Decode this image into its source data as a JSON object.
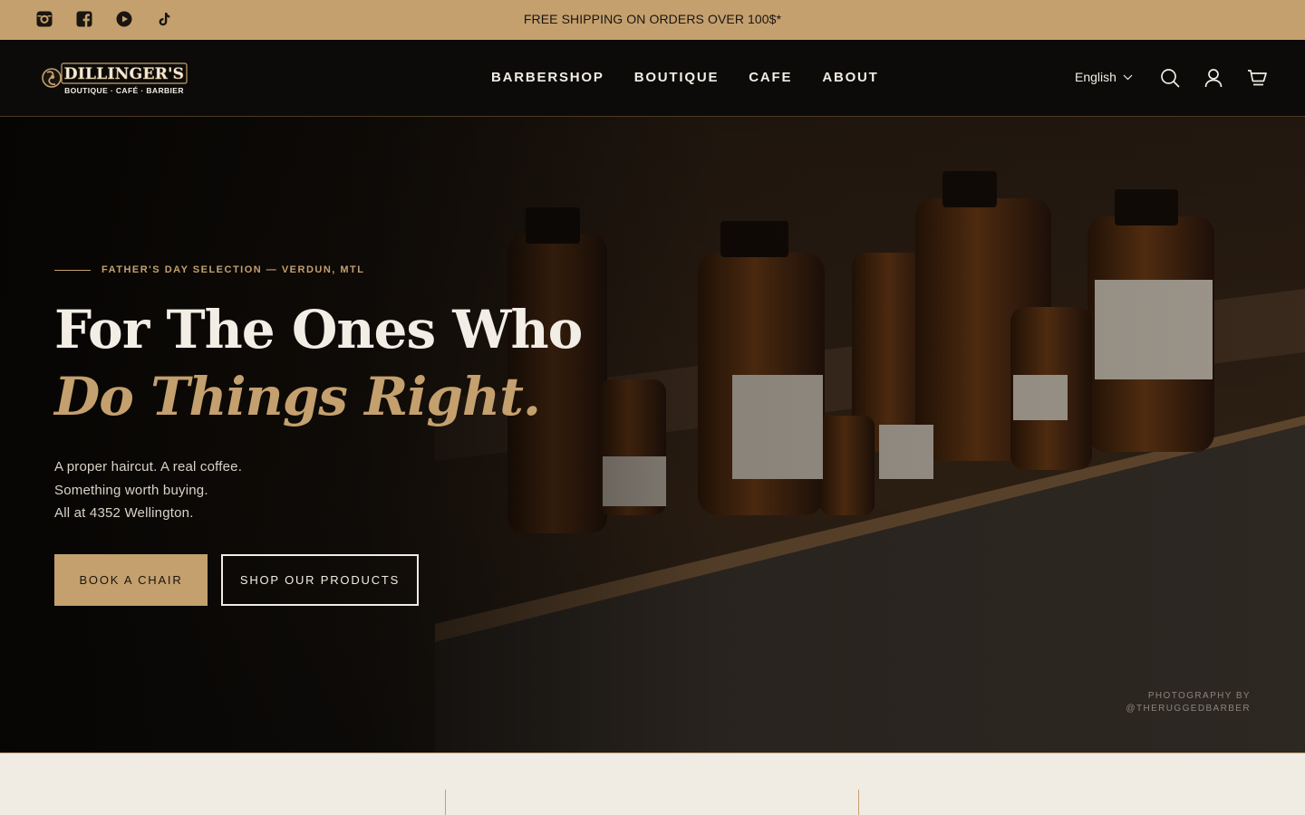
{
  "announcement": {
    "text": "FREE SHIPPING ON ORDERS OVER 100$*",
    "social_icons": [
      "instagram-icon",
      "facebook-icon",
      "youtube-icon",
      "tiktok-icon"
    ]
  },
  "header": {
    "logo": {
      "name": "DILLINGER'S",
      "tagline": "BOUTIQUE · CAFÉ · BARBIER"
    },
    "nav": [
      "BARBERSHOP",
      "BOUTIQUE",
      "CAFE",
      "ABOUT"
    ],
    "language": "English",
    "icons": [
      "search-icon",
      "account-icon",
      "cart-icon"
    ]
  },
  "hero": {
    "eyebrow": "FATHER'S DAY SELECTION — VERDUN, MTL",
    "headline_line1": "For The Ones Who",
    "headline_line2": "Do Things Right.",
    "subtext": [
      "A proper haircut. A real coffee.",
      "Something worth buying.",
      "All at 4352 Wellington."
    ],
    "primary_button": "BOOK A CHAIR",
    "secondary_button": "SHOP OUR PRODUCTS",
    "credit_line1": "PHOTOGRAPHY BY",
    "credit_line2": "@THERUGGEDBARBER"
  },
  "colors": {
    "accent": "#c4a06e",
    "header_bg": "#0c0b09",
    "cream": "#f0ebe3"
  }
}
